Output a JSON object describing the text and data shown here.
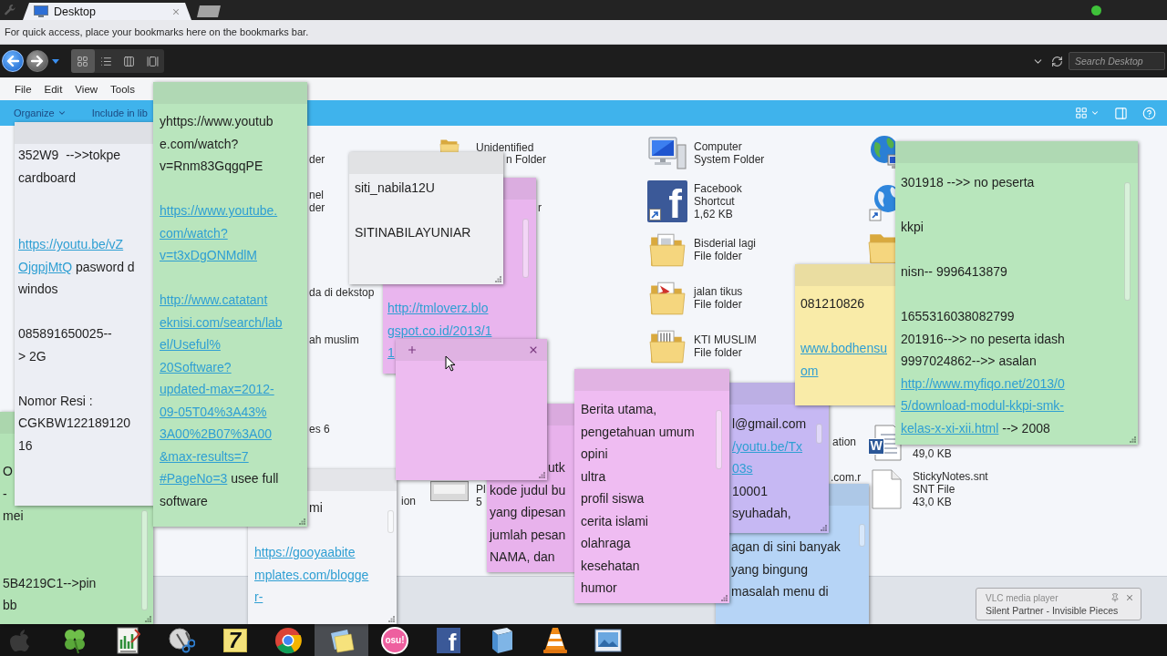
{
  "browser": {
    "tabs": [
      {
        "title": "Desktop",
        "selected": true
      }
    ],
    "bookmarks_bar": {
      "message": "For quick access, place your bookmarks here on the bookmarks bar."
    }
  },
  "explorer": {
    "view_buttons": [
      {
        "kind": "large-icons",
        "selected": true
      },
      {
        "kind": "list",
        "selected": false
      },
      {
        "kind": "columns",
        "selected": false
      },
      {
        "kind": "filmstrip",
        "selected": false
      }
    ],
    "search": {
      "placeholder": "Search Desktop"
    },
    "menu": [
      "File",
      "Edit",
      "View",
      "Tools"
    ],
    "commands": [
      {
        "label": "Organize",
        "dropdown": true
      },
      {
        "label": "Include in lib",
        "dropdown": false
      }
    ],
    "items": [
      {
        "kind": "text",
        "lines": [
          "der"
        ]
      },
      {
        "kind": "folder",
        "lines": [
          "Unidentified"
        ]
      },
      {
        "kind": "text",
        "lines": [
          "n Folder"
        ]
      },
      {
        "kind": "computer",
        "lines": [
          "Computer",
          "System Folder"
        ]
      },
      {
        "kind": "globe-computer"
      },
      {
        "kind": "text",
        "lines": [
          "nel",
          "der"
        ]
      },
      {
        "kind": "text",
        "lines": [
          "r"
        ]
      },
      {
        "kind": "facebook-shortcut",
        "logo": "f",
        "lines": [
          "Facebook",
          "Shortcut",
          "1,62 KB"
        ]
      },
      {
        "kind": "globe-shortcut"
      },
      {
        "kind": "folder-papers",
        "lines": [
          "Bisderial lagi",
          "File folder"
        ]
      },
      {
        "kind": "folder"
      },
      {
        "kind": "text",
        "lines": [
          "da di dekstop"
        ]
      },
      {
        "kind": "folder-pdf",
        "lines": [
          "jalan tikus",
          "File folder"
        ]
      },
      {
        "kind": "text",
        "lines": [
          "ah muslim"
        ]
      },
      {
        "kind": "folder-book",
        "lines": [
          "KTI MUSLIM",
          "File folder"
        ]
      },
      {
        "kind": "text",
        "lines": [
          "es 6"
        ]
      },
      {
        "kind": "text",
        "lines": [
          "ation"
        ]
      },
      {
        "kind": "word-document",
        "logo": "W",
        "lines": [
          "49,0 KB"
        ]
      },
      {
        "kind": "text",
        "lines": [
          "ion"
        ]
      },
      {
        "kind": "image-file",
        "lines": [
          "Pl",
          "5"
        ]
      },
      {
        "kind": "text",
        "lines": [
          ".com.r"
        ]
      },
      {
        "kind": "blank-file",
        "lines": [
          "StickyNotes.snt",
          "SNT File",
          "43,0 KB"
        ]
      }
    ]
  },
  "notes": [
    {
      "color": "#b9e5bd",
      "active": false,
      "scrollable": false,
      "lines": [
        {
          "kind": "text",
          "text": "yhttps://www.youtub"
        },
        {
          "kind": "text",
          "text": "e.com/watch?"
        },
        {
          "kind": "text",
          "text": "v=Rnm83GqgqPE"
        },
        {
          "kind": "blank"
        },
        {
          "kind": "link",
          "text": "https://www.youtube."
        },
        {
          "kind": "link",
          "text": "com/watch?"
        },
        {
          "kind": "link",
          "text": "v=t3xDgONMdlM"
        },
        {
          "kind": "blank"
        },
        {
          "kind": "link",
          "text": "http://www.catatant"
        },
        {
          "kind": "link",
          "text": "eknisi.com/search/lab"
        },
        {
          "kind": "link",
          "text": "el/Useful%"
        },
        {
          "kind": "link",
          "text": "20Software?"
        },
        {
          "kind": "link",
          "text": "updated-max=2012-"
        },
        {
          "kind": "link",
          "text": "09-05T04%3A43%"
        },
        {
          "kind": "link",
          "text": "3A00%2B07%3A00"
        },
        {
          "kind": "link",
          "text": "&max-results=7"
        },
        {
          "kind": "mixed",
          "link": "#PageNo=3",
          "text": " usee full"
        },
        {
          "kind": "text",
          "text": "software"
        }
      ]
    },
    {
      "color": "#eceef4",
      "active": false,
      "scrollable": false,
      "lines": [
        {
          "kind": "text",
          "text": "352W9  -->>tokpe"
        },
        {
          "kind": "text",
          "text": "cardboard"
        },
        {
          "kind": "blank"
        },
        {
          "kind": "blank"
        },
        {
          "kind": "link",
          "text": "https://youtu.be/vZ"
        },
        {
          "kind": "mixed",
          "link": "OjgpjMtQ",
          "text": " pasword d"
        },
        {
          "kind": "text",
          "text": "windos"
        },
        {
          "kind": "blank"
        },
        {
          "kind": "text",
          "text": "085891650025--"
        },
        {
          "kind": "text",
          "text": "> 2G"
        },
        {
          "kind": "blank"
        },
        {
          "kind": "text",
          "text": "Nomor Resi :"
        },
        {
          "kind": "text",
          "text": "CGKBW122189120"
        },
        {
          "kind": "text",
          "text": "16"
        }
      ]
    },
    {
      "color": "#eff0f3",
      "active": false,
      "scrollable": false,
      "lines": [
        {
          "kind": "text",
          "text": "siti_nabila12U"
        },
        {
          "kind": "blank"
        },
        {
          "kind": "text",
          "text": "SITINABILAYUNIAR"
        }
      ]
    },
    {
      "color": "#b8e6bc",
      "active": false,
      "scrollable": true,
      "lines": [
        {
          "kind": "text",
          "text": "301918 -->> no peserta"
        },
        {
          "kind": "blank"
        },
        {
          "kind": "text",
          "text": "kkpi"
        },
        {
          "kind": "blank"
        },
        {
          "kind": "text",
          "text": "nisn-- 9996413879"
        },
        {
          "kind": "blank"
        },
        {
          "kind": "text",
          "text": "1655316038082799"
        },
        {
          "kind": "text",
          "text": "201916-->> no peserta idash"
        },
        {
          "kind": "text",
          "text": "9997024862-->> asalan"
        },
        {
          "kind": "link",
          "text": "http://www.myfiqo.net/2013/0"
        },
        {
          "kind": "link",
          "text": "5/download-modul-kkpi-smk-"
        },
        {
          "kind": "mixed",
          "link": "kelas-x-xi-xii.html",
          "text": " --> 2008"
        }
      ]
    },
    {
      "color": "#e9b5ee",
      "active": false,
      "scrollable": true,
      "lines": [
        {
          "kind": "link",
          "text": "http://tmloverz.blo"
        },
        {
          "kind": "link",
          "text": "gspot.co.id/2013/1"
        },
        {
          "kind": "link",
          "text": "1"
        }
      ]
    },
    {
      "color": "#f9eba8",
      "active": false,
      "scrollable": false,
      "lines": [
        {
          "kind": "text",
          "text": "081210826"
        },
        {
          "kind": "blank"
        },
        {
          "kind": "link",
          "text": "www.bodhensu"
        },
        {
          "kind": "link",
          "text": "om"
        }
      ]
    },
    {
      "color": "#edbbf0",
      "active": true,
      "scrollable": false
    },
    {
      "color": "#efbcf2",
      "active": false,
      "scrollable": true,
      "lines": [
        {
          "kind": "text",
          "text": "Berita utama,"
        },
        {
          "kind": "text",
          "text": "pengetahuan umum"
        },
        {
          "kind": "text",
          "text": "opini"
        },
        {
          "kind": "text",
          "text": "ultra"
        },
        {
          "kind": "text",
          "text": "profil siswa"
        },
        {
          "kind": "text",
          "text": "cerita islami"
        },
        {
          "kind": "text",
          "text": "olahraga"
        },
        {
          "kind": "text",
          "text": "kesehatan"
        },
        {
          "kind": "text",
          "text": "humor"
        }
      ]
    },
    {
      "color": "#c6b8f3",
      "active": false,
      "scrollable": true,
      "lines": [
        {
          "kind": "text",
          "text": "l@gmail.com"
        },
        {
          "kind": "link",
          "text": "/youtu.be/Tx"
        },
        {
          "kind": "link",
          "text": "03s"
        },
        {
          "kind": "text",
          "text": "10001"
        },
        {
          "kind": "text",
          "text": "syuhadah,"
        }
      ]
    },
    {
      "color": "#b3e3b6",
      "scrollable": true,
      "lines": [
        {
          "kind": "text",
          "text": "O"
        },
        {
          "kind": "text",
          "text": "-"
        },
        {
          "kind": "text",
          "text": "mei"
        },
        {
          "kind": "blank"
        },
        {
          "kind": "blank"
        },
        {
          "kind": "text",
          "text": "5B4219C1-->pin"
        },
        {
          "kind": "text",
          "text": "bb"
        }
      ]
    },
    {
      "color": "#e8b2ec",
      "lines": [
        {
          "kind": "text",
          "text": "utk"
        },
        {
          "kind": "text",
          "text": "kode judul bu"
        },
        {
          "kind": "text",
          "text": "yang dipesan"
        },
        {
          "kind": "text",
          "text": "jumlah pesan"
        },
        {
          "kind": "text",
          "text": "NAMA, dan"
        }
      ]
    },
    {
      "color": "#f3f4f8",
      "active": false,
      "scrollable": true,
      "lines": [
        {
          "kind": "text",
          "text": "mi"
        },
        {
          "kind": "blank"
        },
        {
          "kind": "link",
          "text": "https://gooyaabite"
        },
        {
          "kind": "link",
          "text": "mplates.com/blogge"
        },
        {
          "kind": "link",
          "text": "r-"
        }
      ]
    },
    {
      "color": "#b6d4f6",
      "active": false,
      "scrollable": true,
      "lines": [
        {
          "kind": "text",
          "text": "agan di sini banyak"
        },
        {
          "kind": "text",
          "text": "yang bingung"
        },
        {
          "kind": "text",
          "text": "masalah menu di"
        }
      ]
    }
  ],
  "taskbar": {
    "items": [
      {
        "kind": "start",
        "active": false
      },
      {
        "kind": "clover",
        "active": false
      },
      {
        "kind": "notepad-chart",
        "active": false
      },
      {
        "kind": "scissors",
        "active": false
      },
      {
        "kind": "number-tile",
        "label": "7",
        "active": false
      },
      {
        "kind": "browser",
        "active": false
      },
      {
        "kind": "sticky-notes",
        "active": true
      },
      {
        "kind": "round-logo",
        "label": "osu!",
        "active": false
      },
      {
        "kind": "square-logo",
        "label": "f",
        "active": false
      },
      {
        "kind": "book",
        "active": false
      },
      {
        "kind": "cone",
        "active": false
      },
      {
        "kind": "picture",
        "active": false
      }
    ]
  },
  "notification": {
    "title": "VLC media player",
    "text": "Silent Partner - Invisible Pieces"
  }
}
